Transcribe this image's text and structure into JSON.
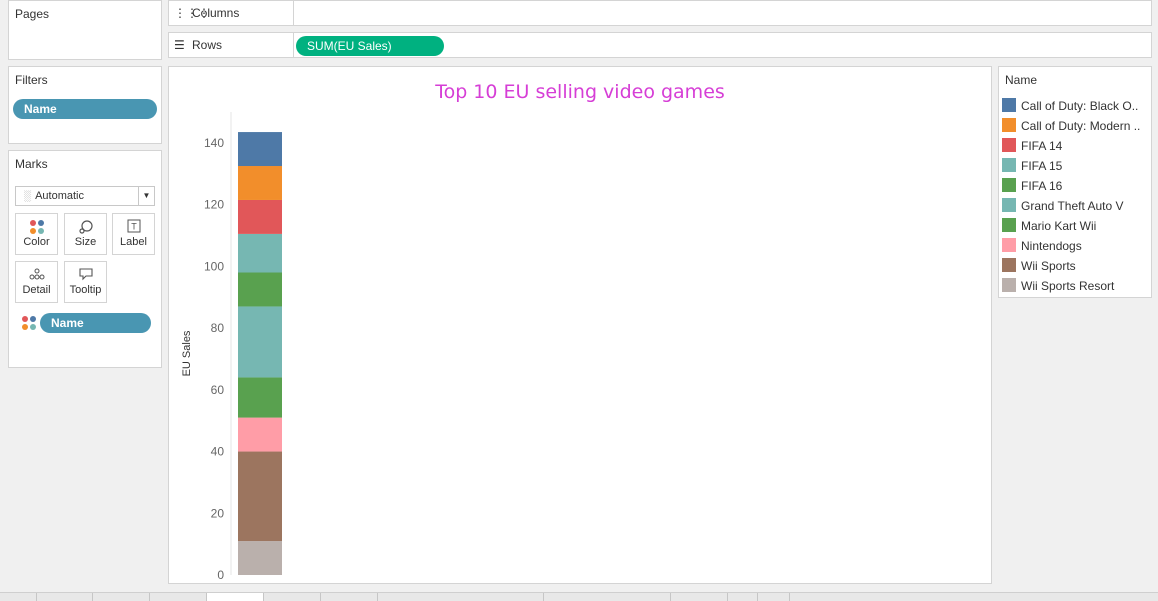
{
  "pages": {
    "title": "Pages"
  },
  "filters": {
    "title": "Filters",
    "pill": "Name"
  },
  "marks": {
    "title": "Marks",
    "type": "Automatic",
    "buttons": [
      {
        "label": "Color",
        "icon": "color-dots-icon"
      },
      {
        "label": "Size",
        "icon": "size-icon"
      },
      {
        "label": "Label",
        "icon": "label-icon"
      },
      {
        "label": "Detail",
        "icon": "detail-icon"
      },
      {
        "label": "Tooltip",
        "icon": "tooltip-icon"
      }
    ],
    "color_pill": "Name"
  },
  "columns_shelf": {
    "label": "Columns"
  },
  "rows_shelf": {
    "label": "Rows",
    "pill": "SUM(EU Sales)"
  },
  "legend": {
    "title": "Name",
    "items": [
      {
        "label": "Call of Duty: Black O..",
        "color": "#4e79a7"
      },
      {
        "label": "Call of Duty: Modern ..",
        "color": "#f28e2b"
      },
      {
        "label": "FIFA 14",
        "color": "#e15759"
      },
      {
        "label": "FIFA 15",
        "color": "#76b7b2"
      },
      {
        "label": "FIFA 16",
        "color": "#59a14f"
      },
      {
        "label": "Grand Theft Auto V",
        "color": "#76b7b2"
      },
      {
        "label": "Mario Kart Wii",
        "color": "#59a14f"
      },
      {
        "label": "Nintendogs",
        "color": "#ff9da7"
      },
      {
        "label": "Wii Sports",
        "color": "#9c755f"
      },
      {
        "label": "Wii Sports Resort",
        "color": "#bab0ac"
      }
    ]
  },
  "chart_data": {
    "type": "bar",
    "stacked": true,
    "title": "Top 10 EU selling video games",
    "ylabel": "EU Sales",
    "xlabel": "",
    "ylim": [
      0,
      150
    ],
    "yticks": [
      0,
      20,
      40,
      60,
      80,
      100,
      120,
      140
    ],
    "series": [
      {
        "name": "Wii Sports Resort",
        "value": 11.0,
        "color": "#bab0ac"
      },
      {
        "name": "Wii Sports",
        "value": 29.0,
        "color": "#9c755f"
      },
      {
        "name": "Nintendogs",
        "value": 11.0,
        "color": "#ff9da7"
      },
      {
        "name": "Mario Kart Wii",
        "value": 13.0,
        "color": "#59a14f"
      },
      {
        "name": "Grand Theft Auto V",
        "value": 23.0,
        "color": "#76b7b2"
      },
      {
        "name": "FIFA 16",
        "value": 11.0,
        "color": "#59a14f"
      },
      {
        "name": "FIFA 15",
        "value": 12.5,
        "color": "#76b7b2"
      },
      {
        "name": "FIFA 14",
        "value": 11.0,
        "color": "#e15759"
      },
      {
        "name": "Call of Duty: Modern ..",
        "value": 11.0,
        "color": "#f28e2b"
      },
      {
        "name": "Call of Duty: Black O..",
        "value": 11.0,
        "color": "#4e79a7"
      }
    ]
  }
}
